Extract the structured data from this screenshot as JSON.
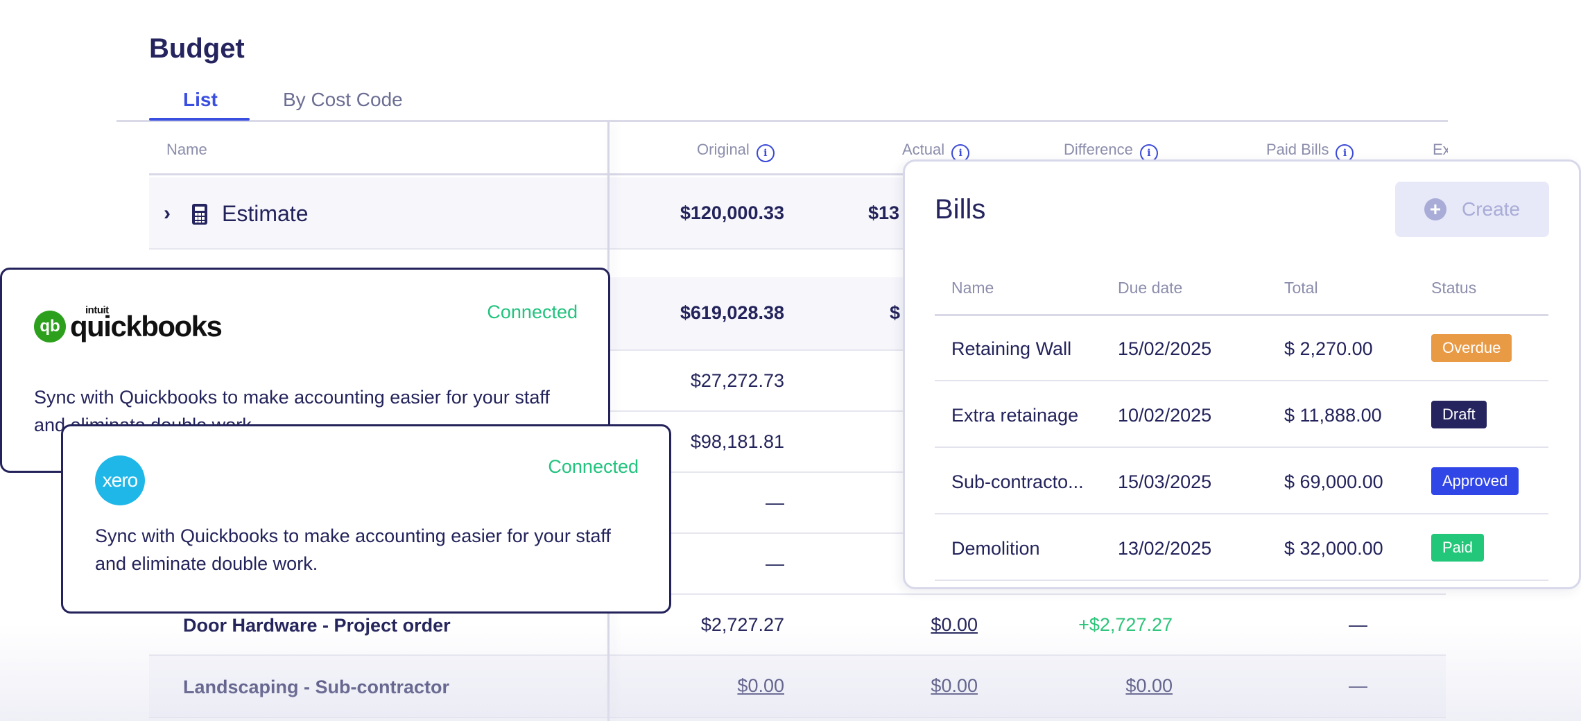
{
  "budget": {
    "title": "Budget",
    "tabs": [
      {
        "label": "List",
        "active": true
      },
      {
        "label": "By Cost Code",
        "active": false
      }
    ],
    "columns": {
      "name": "Name",
      "original": "Original",
      "actual": "Actual",
      "difference": "Difference",
      "paid_bills": "Paid Bills",
      "expected": "Ex"
    },
    "rows": [
      {
        "name": "Estimate",
        "original": "$120,000.33",
        "actual": "$13"
      },
      {
        "original": "$619,028.38",
        "actual": "$"
      },
      {
        "original": "$27,272.73"
      },
      {
        "original": "$98,181.81"
      },
      {
        "original": "—"
      },
      {
        "original": "—"
      },
      {
        "name": "Door Hardware - Project order",
        "original": "$2,727.27",
        "actual": "$0.00",
        "difference": "+$2,727.27",
        "paid_bills": "—"
      },
      {
        "name": "Landscaping - Sub-contractor",
        "original": "$0.00",
        "actual": "$0.00",
        "difference": "$0.00",
        "paid_bills": "—"
      }
    ]
  },
  "integrations": {
    "quickbooks": {
      "logo_small": "intuit",
      "logo_name": "quickbooks",
      "logo_mark": "qb",
      "status": "Connected",
      "description": "Sync with Quickbooks to make accounting easier for your staff and eliminate double work."
    },
    "xero": {
      "logo_name": "xero",
      "status": "Connected",
      "description": "Sync with Quickbooks to make accounting easier for your staff and eliminate double work."
    }
  },
  "bills": {
    "title": "Bills",
    "create_label": "Create",
    "columns": {
      "name": "Name",
      "due_date": "Due date",
      "total": "Total",
      "status": "Status"
    },
    "rows": [
      {
        "name": "Retaining Wall",
        "due_date": "15/02/2025",
        "total": "$ 2,270.00",
        "status": "Overdue"
      },
      {
        "name": "Extra retainage",
        "due_date": "10/02/2025",
        "total": "$ 11,888.00",
        "status": "Draft"
      },
      {
        "name": "Sub-contracto...",
        "due_date": "15/03/2025",
        "total": "$ 69,000.00",
        "status": "Approved"
      },
      {
        "name": "Demolition",
        "due_date": "13/02/2025",
        "total": "$ 32,000.00",
        "status": "Paid"
      }
    ]
  },
  "colors": {
    "primary": "#3a4ee0",
    "navy": "#23225a",
    "connected": "#22c37e",
    "overdue": "#e99a45",
    "draft": "#25245e",
    "approved": "#3146e6",
    "paid": "#23c77a"
  }
}
